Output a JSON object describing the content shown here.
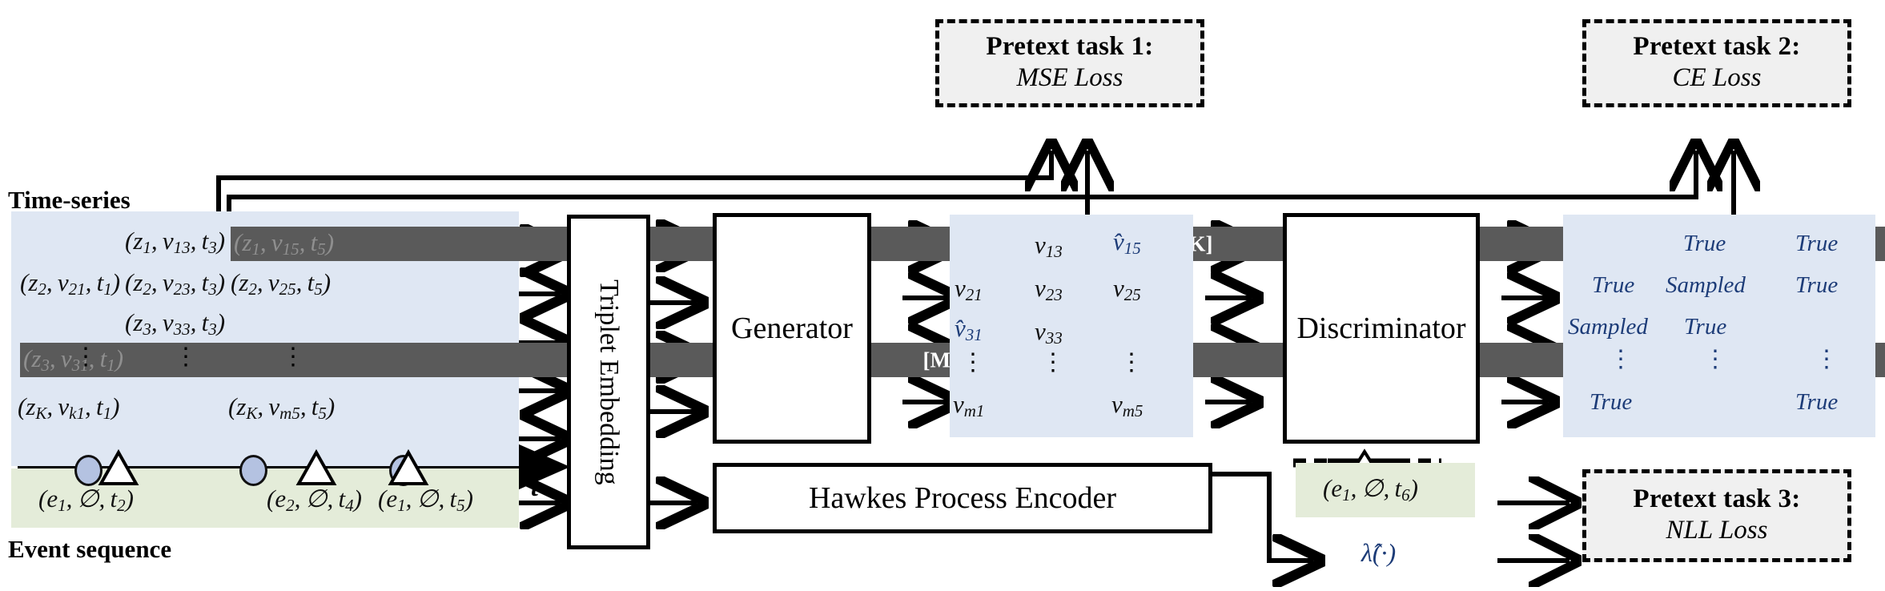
{
  "figure": {
    "type": "architecture-diagram",
    "labels": {
      "time_series": "Time-series",
      "event_sequence": "Event sequence",
      "time_axis": "t"
    },
    "colors": {
      "timeseries_panel": "#dfe7f3",
      "event_panel": "#e4ecd9",
      "mask_fill": "#5a5a5a",
      "hat_blue": "#1d3c78",
      "loss_box_fill": "#f0f0f0"
    }
  },
  "timeseries_tokens": {
    "col1": [
      "(z2, v21, t1)",
      "(z3, v31, t1)",
      "⋮",
      "(zK, vk1, t1)"
    ],
    "col2": [
      "(z1, v13, t3)",
      "(z2, v23, t3)",
      "(z3, v33, t3)",
      "⋮"
    ],
    "col3": [
      "(z1, v15, t5)",
      "(z2, v25, t5)",
      "⋮",
      "(zK, vm5, t5)"
    ],
    "mask_label": "[MASK]",
    "masked": [
      "(z1, v15, t5)",
      "(z3, v31, t1)"
    ],
    "rows": [
      {
        "c1": "",
        "c2": "z_1,v_13,t_3",
        "c3": "z_1,v_15,t_5",
        "c3_masked": true
      },
      {
        "c1": "z_2,v_21,t_1",
        "c2": "z_2,v_23,t_3",
        "c3": "z_2,v_25,t_5"
      },
      {
        "c1": "z_3,v_31,t_1",
        "c1_masked": true,
        "c2": "z_3,v_33,t_3",
        "c3": ""
      },
      {
        "c1": "⋮",
        "c2": "⋮",
        "c3": "⋮"
      },
      {
        "c1": "z_K,v_k1,t_1",
        "c2": "",
        "c3": "z_K,v_m5,t_5"
      }
    ]
  },
  "event_tokens": [
    "(e1, ∅, t2)",
    "(e2, ∅, t4)",
    "(e1, ∅, t5)"
  ],
  "predicted_event": "(e1, ∅, t6)",
  "intensity_label": "λ̂(·)",
  "blocks": {
    "triplet_embedding": "Triplet Embedding",
    "generator": "Generator",
    "discriminator": "Discriminator",
    "hawkes_encoder": "Hawkes Process Encoder"
  },
  "generator_output": {
    "rows": [
      {
        "c1": "",
        "c2": "v_13",
        "c3": "v̂_15",
        "c3_hat": true
      },
      {
        "c1": "v_21",
        "c2": "v_23",
        "c3": "v_25"
      },
      {
        "c1": "v̂_31",
        "c1_hat": true,
        "c2": "v_33",
        "c3": ""
      },
      {
        "c1": "⋮",
        "c2": "⋮",
        "c3": "⋮"
      },
      {
        "c1": "v_m1",
        "c2": "",
        "c3": "v_m5"
      }
    ]
  },
  "discriminator_output": {
    "true_label": "True",
    "sampled_label": "Sampled",
    "rows": [
      {
        "c1": "",
        "c2": "True",
        "c3": "True"
      },
      {
        "c1": "True",
        "c2": "Sampled",
        "c3": "True"
      },
      {
        "c1": "Sampled",
        "c2": "True",
        "c3": ""
      },
      {
        "c1": "⋮",
        "c2": "⋮",
        "c3": "⋮"
      },
      {
        "c1": "True",
        "c2": "",
        "c3": "True"
      }
    ]
  },
  "pretext_tasks": [
    {
      "title": "Pretext task 1:",
      "loss": "MSE Loss"
    },
    {
      "title": "Pretext task 2:",
      "loss": "CE Loss"
    },
    {
      "title": "Pretext task 3:",
      "loss": "NLL Loss"
    }
  ]
}
